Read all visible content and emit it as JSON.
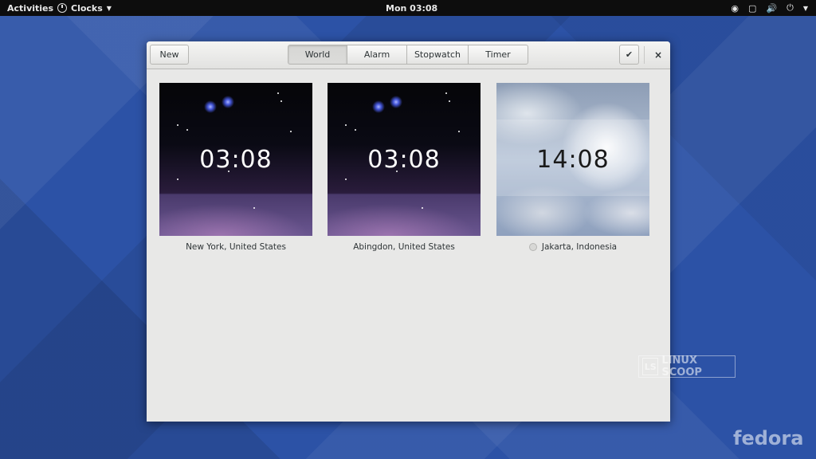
{
  "topbar": {
    "activities": "Activities",
    "app_name": "Clocks",
    "clock": "Mon 03:08"
  },
  "headerbar": {
    "new_label": "New",
    "tabs": [
      "World",
      "Alarm",
      "Stopwatch",
      "Timer"
    ],
    "active_tab": "World",
    "check_glyph": "✔",
    "close_glyph": "×"
  },
  "clocks": [
    {
      "time": "03:08",
      "city": "New York, United States",
      "theme": "night"
    },
    {
      "time": "03:08",
      "city": "Abingdon, United States",
      "theme": "night"
    },
    {
      "time": "14:08",
      "city": "Jakarta, Indonesia",
      "theme": "day"
    }
  ],
  "watermark": {
    "box": "LS",
    "text": "LINUX SCOOP"
  },
  "fedora": "fedora",
  "icons": [
    "clock-icon",
    "caret-down-icon",
    "accessibility-icon",
    "window-icon",
    "volume-icon",
    "power-icon",
    "check-icon",
    "close-icon"
  ]
}
